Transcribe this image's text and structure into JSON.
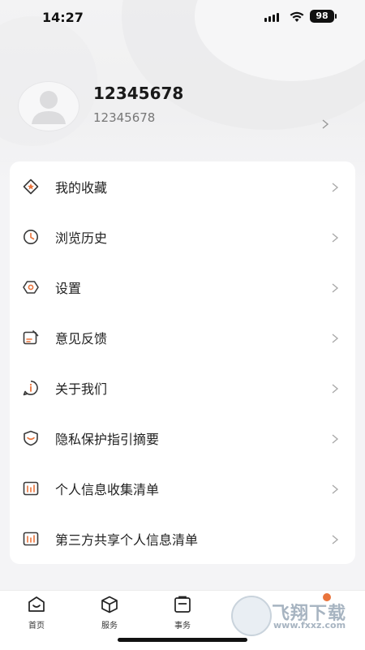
{
  "status": {
    "time": "14:27",
    "battery": "98"
  },
  "profile": {
    "name": "12345678",
    "id": "12345678"
  },
  "menu": [
    {
      "label": "我的收藏",
      "icon": "star-icon"
    },
    {
      "label": "浏览历史",
      "icon": "clock-icon"
    },
    {
      "label": "设置",
      "icon": "gear-icon"
    },
    {
      "label": "意见反馈",
      "icon": "feedback-icon"
    },
    {
      "label": "关于我们",
      "icon": "info-icon"
    },
    {
      "label": "隐私保护指引摘要",
      "icon": "shield-icon"
    },
    {
      "label": "个人信息收集清单",
      "icon": "chart-list-icon"
    },
    {
      "label": "第三方共享个人信息清单",
      "icon": "chart-list-icon"
    }
  ],
  "tabs": [
    {
      "label": "首页",
      "icon": "home-icon"
    },
    {
      "label": "服务",
      "icon": "box-icon"
    },
    {
      "label": "事务",
      "icon": "clipboard-icon"
    }
  ],
  "watermark": {
    "text": "飞翔下载",
    "url": "www.fxxz.com"
  },
  "colors": {
    "accent": "#e9743c",
    "icon_dark": "#3a3a3a"
  }
}
